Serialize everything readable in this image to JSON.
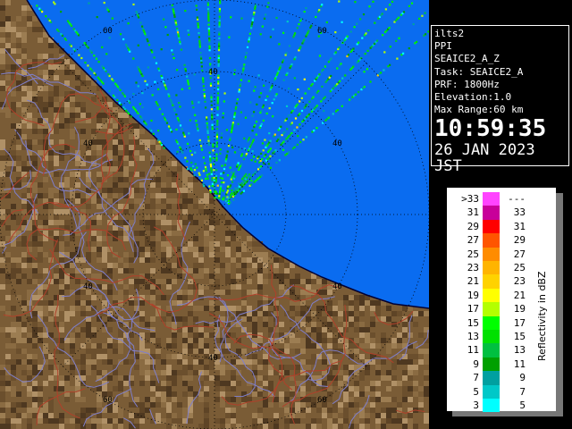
{
  "station": "ilts2",
  "scan_type": "PPI",
  "product": "SEAICE2_A_Z",
  "task": "Task: SEAICE2_A",
  "prf": "PRF: 1800Hz",
  "elevation": "Elevation:1.0",
  "max_range": "Max Range:60 km",
  "time": "10:59:35",
  "date": "26 JAN 2023 JST",
  "range_ring_labels": [
    "40",
    "60"
  ],
  "colors": {
    "sea": "#0a6cf0",
    "land": "#7a5c36",
    "rivers": "#7f7fcc",
    "boundaries": "#b0402a",
    "coastline": "#000033"
  },
  "legend": {
    "title": "Reflectivity in dBZ",
    "rows": [
      {
        "lo": ">33",
        "hi": "---",
        "color": "#ff44ff"
      },
      {
        "lo": "31",
        "hi": "33",
        "color": "#c8009a"
      },
      {
        "lo": "29",
        "hi": "31",
        "color": "#ff0000"
      },
      {
        "lo": "27",
        "hi": "29",
        "color": "#ff5500"
      },
      {
        "lo": "25",
        "hi": "27",
        "color": "#ff8c00"
      },
      {
        "lo": "23",
        "hi": "25",
        "color": "#ffb400"
      },
      {
        "lo": "21",
        "hi": "23",
        "color": "#ffd200"
      },
      {
        "lo": "19",
        "hi": "21",
        "color": "#ffff00"
      },
      {
        "lo": "17",
        "hi": "19",
        "color": "#b4ff00"
      },
      {
        "lo": "15",
        "hi": "17",
        "color": "#00ff00"
      },
      {
        "lo": "13",
        "hi": "15",
        "color": "#00e000"
      },
      {
        "lo": "11",
        "hi": "13",
        "color": "#00c040"
      },
      {
        "lo": "9",
        "hi": "11",
        "color": "#00a000"
      },
      {
        "lo": "7",
        "hi": "9",
        "color": "#00a0a0"
      },
      {
        "lo": "5",
        "hi": "7",
        "color": "#00c8c8"
      },
      {
        "lo": "3",
        "hi": "5",
        "color": "#00ffff"
      }
    ]
  }
}
